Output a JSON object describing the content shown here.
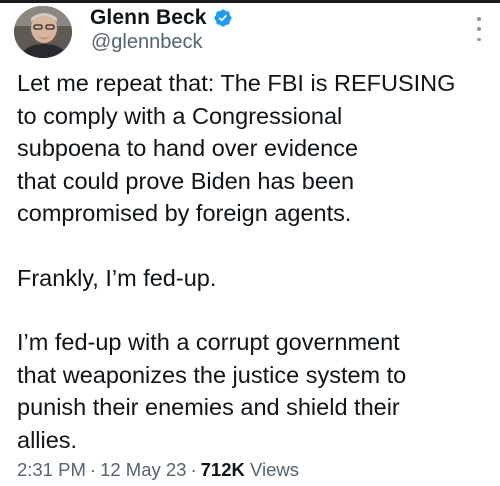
{
  "author": {
    "name": "Glenn Beck",
    "handle": "@glennbeck",
    "avatar_icon": "profile-photo",
    "verified_icon": "verified-badge-icon",
    "verified_color": "#1d9bf0"
  },
  "tweet": {
    "paragraphs": [
      {
        "lines": [
          "Let me repeat that: The FBI is REFUSING",
          "to comply with a Congressional",
          "subpoena to hand over evidence",
          "that could prove Biden has been",
          "compromised by foreign agents."
        ]
      },
      {
        "lines": [
          "Frankly, I’m fed-up."
        ]
      },
      {
        "lines": [
          "I’m fed-up with a corrupt government",
          "that weaponizes the justice system to",
          "punish their enemies and shield their",
          "allies."
        ]
      }
    ]
  },
  "meta": {
    "time": "2:31 PM",
    "separator": "·",
    "date": "12 May 23",
    "views_count": "712K",
    "views_label": "Views"
  },
  "more_icon": "more-options-icon"
}
